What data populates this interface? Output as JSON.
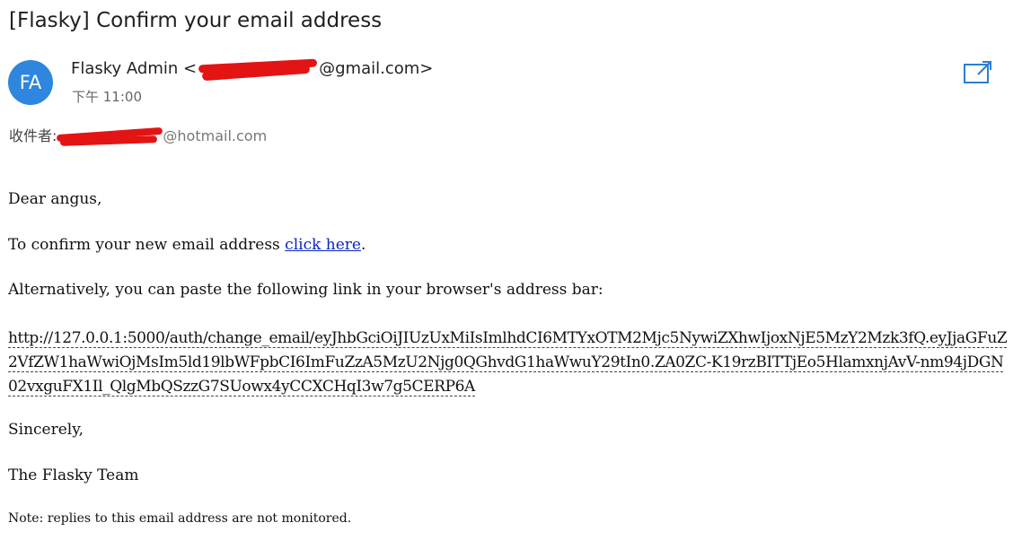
{
  "email": {
    "subject": "[Flasky] Confirm your email address",
    "sender": {
      "avatar_initials": "FA",
      "avatar_color": "#2e86de",
      "name": "Flasky Admin",
      "email_prefix": "<",
      "email_visible_suffix": "@gmail.com>"
    },
    "time": "下午 11:00",
    "recipient": {
      "label": "收件者:",
      "email_visible_suffix": "@hotmail.com"
    },
    "body": {
      "greeting": "Dear angus,",
      "confirm_text": "To confirm your new email address ",
      "confirm_link": "click here",
      "confirm_end": ".",
      "alternative_text": "Alternatively, you can paste the following link in your browser's address bar:",
      "long_url": "http://127.0.0.1:5000/auth/change_email/eyJhbGciOiJIUzUxMiIsImlhdCI6MTYxOTM2Mjc5NywiZXhwIjoxNjE5MzY2Mzk3fQ.eyJjaGFuZ2VfZW1haWwiOjMsIm5ld19lbWFpbCI6ImFuZzA5MzU2Njg0QGhvdG1haWwuY29tIn0.ZA0ZC-K19rzBITTjEo5HlamxnjAvV-nm94jDGN02vxguFX1Il_QlgMbQSzzG7SUowx4yCCXCHqI3w7g5CERP6A",
      "closing": "Sincerely,",
      "signature": "The Flasky Team",
      "note": "Note: replies to this email address are not monitored."
    }
  }
}
